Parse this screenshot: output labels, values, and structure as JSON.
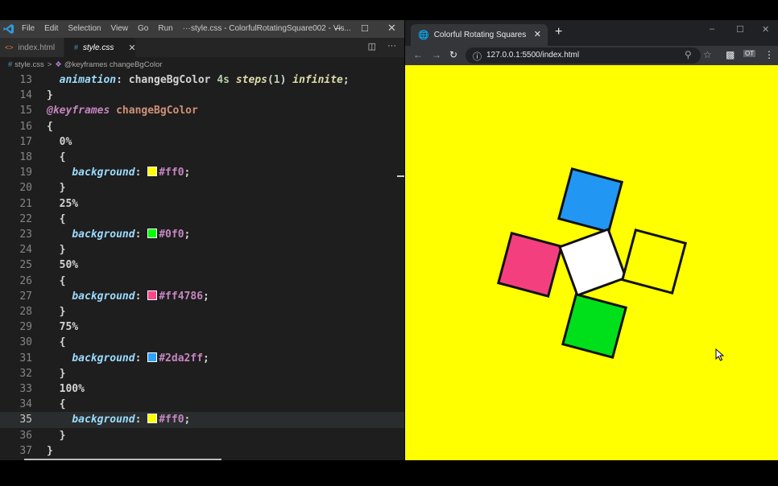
{
  "vscode": {
    "menu": [
      "File",
      "Edit",
      "Selection",
      "View",
      "Go",
      "Run",
      "···"
    ],
    "window_title": "style.css - ColorfulRotatingSquare002 - Vis...",
    "tabs": [
      {
        "icon": "<>",
        "label": "index.html"
      },
      {
        "icon": "#",
        "label": "style.css",
        "close": "✕"
      }
    ],
    "breadcrumb": {
      "file": "style.css",
      "sep": ">",
      "symbol": "@keyframes changeBgColor"
    },
    "lines": [
      {
        "n": "13",
        "parts": [
          [
            "prop",
            "  animation"
          ],
          [
            "plain",
            ": "
          ],
          [
            "plain",
            "changeBgColor "
          ],
          [
            "num",
            "4s "
          ],
          [
            "fn",
            "steps"
          ],
          [
            "plain",
            "("
          ],
          [
            "num",
            "1"
          ],
          [
            "plain",
            ") "
          ],
          [
            "fn",
            "infinite"
          ],
          [
            "plain",
            ";"
          ]
        ]
      },
      {
        "n": "14",
        "parts": [
          [
            "plain",
            "}"
          ]
        ]
      },
      {
        "n": "15",
        "parts": [
          [
            "kw",
            "@keyframes "
          ],
          [
            "str",
            "changeBgColor"
          ]
        ]
      },
      {
        "n": "16",
        "parts": [
          [
            "plain",
            "{"
          ]
        ]
      },
      {
        "n": "17",
        "parts": [
          [
            "plain",
            "  0%"
          ]
        ]
      },
      {
        "n": "18",
        "parts": [
          [
            "plain",
            "  {"
          ]
        ]
      },
      {
        "n": "19",
        "parts": [
          [
            "prop",
            "    background"
          ],
          [
            "plain",
            ": "
          ],
          [
            "swatch",
            "#ffff00"
          ],
          [
            "hex",
            "#ff0"
          ],
          [
            "plain",
            ";"
          ]
        ]
      },
      {
        "n": "20",
        "parts": [
          [
            "plain",
            "  }"
          ]
        ]
      },
      {
        "n": "21",
        "parts": [
          [
            "plain",
            "  25%"
          ]
        ]
      },
      {
        "n": "22",
        "parts": [
          [
            "plain",
            "  {"
          ]
        ]
      },
      {
        "n": "23",
        "parts": [
          [
            "prop",
            "    background"
          ],
          [
            "plain",
            ": "
          ],
          [
            "swatch",
            "#00ff00"
          ],
          [
            "hex",
            "#0f0"
          ],
          [
            "plain",
            ";"
          ]
        ]
      },
      {
        "n": "24",
        "parts": [
          [
            "plain",
            "  }"
          ]
        ]
      },
      {
        "n": "25",
        "parts": [
          [
            "plain",
            "  50%"
          ]
        ]
      },
      {
        "n": "26",
        "parts": [
          [
            "plain",
            "  {"
          ]
        ]
      },
      {
        "n": "27",
        "parts": [
          [
            "prop",
            "    background"
          ],
          [
            "plain",
            ": "
          ],
          [
            "swatch",
            "#ff4786"
          ],
          [
            "hex",
            "#ff4786"
          ],
          [
            "plain",
            ";"
          ]
        ]
      },
      {
        "n": "28",
        "parts": [
          [
            "plain",
            "  }"
          ]
        ]
      },
      {
        "n": "29",
        "parts": [
          [
            "plain",
            "  75%"
          ]
        ]
      },
      {
        "n": "30",
        "parts": [
          [
            "plain",
            "  {"
          ]
        ]
      },
      {
        "n": "31",
        "parts": [
          [
            "prop",
            "    background"
          ],
          [
            "plain",
            ": "
          ],
          [
            "swatch",
            "#2da2ff"
          ],
          [
            "hex",
            "#2da2ff"
          ],
          [
            "plain",
            ";"
          ]
        ]
      },
      {
        "n": "32",
        "parts": [
          [
            "plain",
            "  }"
          ]
        ]
      },
      {
        "n": "33",
        "parts": [
          [
            "plain",
            "  100%"
          ]
        ]
      },
      {
        "n": "34",
        "parts": [
          [
            "plain",
            "  {"
          ]
        ]
      },
      {
        "n": "35",
        "current": true,
        "parts": [
          [
            "prop",
            "    background"
          ],
          [
            "plain",
            ": "
          ],
          [
            "swatch",
            "#ffff00"
          ],
          [
            "hex",
            "#ff0"
          ],
          [
            "plain",
            ";"
          ]
        ]
      },
      {
        "n": "36",
        "parts": [
          [
            "plain",
            "  }"
          ]
        ]
      },
      {
        "n": "37",
        "parts": [
          [
            "plain",
            "}"
          ]
        ]
      }
    ]
  },
  "browser": {
    "tab_title": "Colorful Rotating Squares",
    "tab_close": "✕",
    "new_tab": "+",
    "url": "127.0.0.1:5500/index.html",
    "page_background": "#ffff00",
    "squares": [
      {
        "name": "square-blue",
        "color": "#2196f3"
      },
      {
        "name": "square-pink",
        "color": "#f43f7f"
      },
      {
        "name": "square-center",
        "color": "#ffffff"
      },
      {
        "name": "square-yellow",
        "color": "#ffff00"
      },
      {
        "name": "square-green",
        "color": "#00e01a"
      }
    ]
  }
}
